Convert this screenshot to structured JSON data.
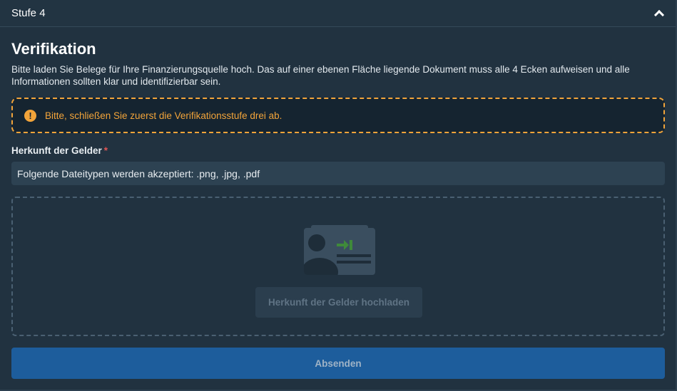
{
  "header": {
    "title": "Stufe 4",
    "collapse_icon": "chevron-up-icon"
  },
  "main": {
    "title": "Verifikation",
    "description": "Bitte laden Sie Belege für Ihre Finanzierungsquelle hoch. Das auf einer ebenen Fläche liegende Dokument muss alle 4 Ecken aufweisen und alle Informationen sollten klar und identifizierbar sein."
  },
  "alert": {
    "icon": "warning-icon",
    "icon_glyph": "!",
    "text": "Bitte, schließen Sie zuerst die Verifikationsstufe drei ab.",
    "color": "#f2a43a"
  },
  "field": {
    "label": "Herkunft der Gelder",
    "required_marker": "*",
    "accepted_types_text": "Folgende Dateitypen werden akzeptiert: .png, .jpg, .pdf"
  },
  "dropzone": {
    "illustration_icon": "id-card-icon",
    "upload_label": "Herkunft der Gelder hochladen"
  },
  "submit": {
    "label": "Absenden",
    "color": "#1d5d9c"
  }
}
